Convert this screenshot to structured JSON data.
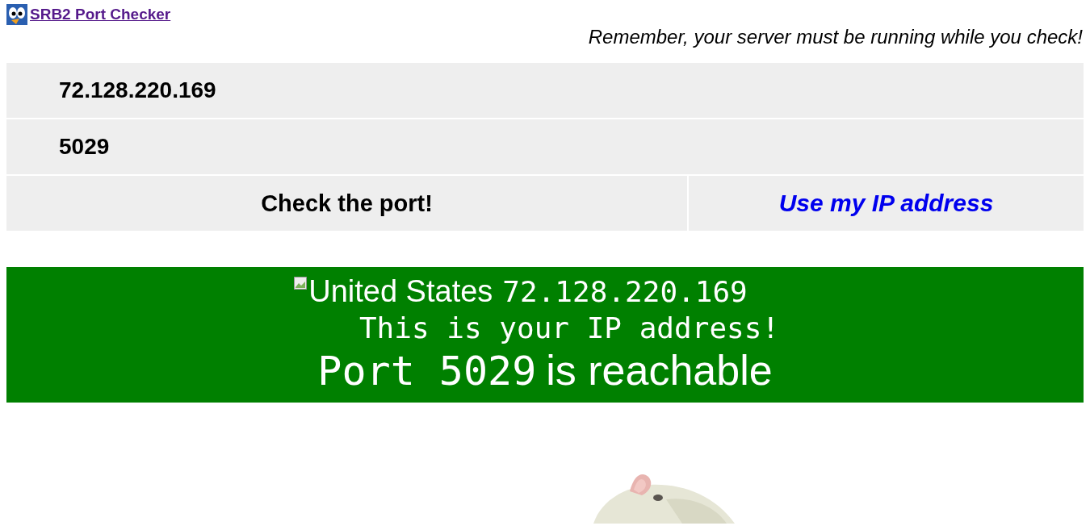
{
  "header": {
    "title": "SRB2 Port Checker",
    "notice": "Remember, your server must be running while you check!"
  },
  "form": {
    "address": "72.128.220.169",
    "port": "5029",
    "check_button": "Check the port!",
    "use_ip_link": "Use my IP address"
  },
  "result": {
    "reachable": true,
    "country": "United States",
    "ip": "72.128.220.169",
    "message": "This is your IP address!",
    "port_label": "Port 5029",
    "verdict": "is reachable"
  }
}
